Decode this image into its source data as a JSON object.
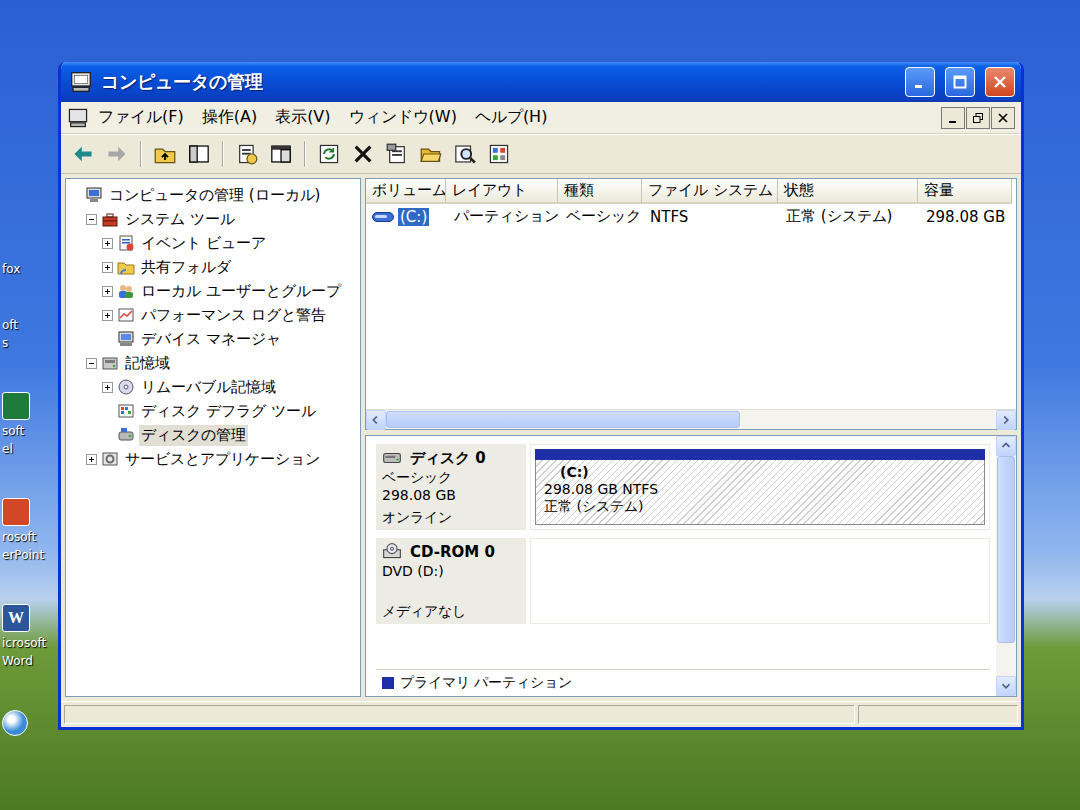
{
  "desktop_icons": [
    {
      "lines": [
        "fox"
      ],
      "kind": "none"
    },
    {
      "lines": [
        "oft",
        "s"
      ],
      "kind": "none"
    },
    {
      "lines": [
        "soft",
        "el"
      ],
      "kind": "tile",
      "color": "#1d7a3a"
    },
    {
      "lines": [
        "rosoft",
        "erPoint"
      ],
      "kind": "tile",
      "color": "#d24726"
    },
    {
      "lines": [
        "icrosoft",
        "Word"
      ],
      "kind": "tile",
      "color": "#2b579a",
      "glyph": "W"
    },
    {
      "lines": [],
      "kind": "round",
      "color": "#3b8ad8"
    }
  ],
  "window": {
    "title": "コンピュータの管理",
    "active": true
  },
  "menu": [
    "ファイル(F)",
    "操作(A)",
    "表示(V)",
    "ウィンドウ(W)",
    "ヘルプ(H)"
  ],
  "toolbar": [
    {
      "kind": "back",
      "disabled": false
    },
    {
      "kind": "forward",
      "disabled": true
    },
    {
      "kind": "separator",
      "disabled": false
    },
    {
      "kind": "up-folder",
      "disabled": false
    },
    {
      "kind": "show-tree",
      "disabled": false
    },
    {
      "kind": "separator",
      "disabled": false
    },
    {
      "kind": "help",
      "disabled": false
    },
    {
      "kind": "console",
      "disabled": false
    },
    {
      "kind": "separator",
      "disabled": false
    },
    {
      "kind": "refresh",
      "disabled": false
    },
    {
      "kind": "delete",
      "disabled": false
    },
    {
      "kind": "properties",
      "disabled": false
    },
    {
      "kind": "open",
      "disabled": false
    },
    {
      "kind": "find",
      "disabled": false
    },
    {
      "kind": "settings",
      "disabled": false
    }
  ],
  "tree": [
    {
      "label": "コンピュータの管理 (ローカル)",
      "level": 0,
      "kind": "computer",
      "expandable": false,
      "expanded": false,
      "selected": false
    },
    {
      "label": "システム ツール",
      "level": 1,
      "kind": "toolbox",
      "expandable": true,
      "expanded": true,
      "selected": false
    },
    {
      "label": "イベント ビューア",
      "level": 2,
      "kind": "event-log",
      "expandable": true,
      "expanded": false,
      "selected": false
    },
    {
      "label": "共有フォルダ",
      "level": 2,
      "kind": "shared-folder",
      "expandable": true,
      "expanded": false,
      "selected": false
    },
    {
      "label": "ローカル ユーザーとグループ",
      "level": 2,
      "kind": "users",
      "expandable": true,
      "expanded": false,
      "selected": false
    },
    {
      "label": "パフォーマンス ログと警告",
      "level": 2,
      "kind": "performance",
      "expandable": true,
      "expanded": false,
      "selected": false
    },
    {
      "label": "デバイス マネージャ",
      "level": 2,
      "kind": "device-manager",
      "expandable": false,
      "expanded": false,
      "selected": false
    },
    {
      "label": "記憶域",
      "level": 1,
      "kind": "storage",
      "expandable": true,
      "expanded": true,
      "selected": false
    },
    {
      "label": "リムーバブル記憶域",
      "level": 2,
      "kind": "removable-storage",
      "expandable": true,
      "expanded": false,
      "selected": false
    },
    {
      "label": "ディスク デフラグ ツール",
      "level": 2,
      "kind": "defrag",
      "expandable": false,
      "expanded": false,
      "selected": false
    },
    {
      "label": "ディスクの管理",
      "level": 2,
      "kind": "disk-management",
      "expandable": false,
      "expanded": false,
      "selected": true
    },
    {
      "label": "サービスとアプリケーション",
      "level": 1,
      "kind": "services",
      "expandable": true,
      "expanded": false,
      "selected": false
    }
  ],
  "volume_table": {
    "columns": [
      "ボリューム",
      "レイアウト",
      "種類",
      "ファイル システム",
      "状態",
      "容量"
    ],
    "rows": [
      {
        "cells": [
          "(C:)",
          "パーティション",
          "ベーシック",
          "NTFS",
          "正常 (システム)",
          "298.08 GB"
        ],
        "selected": true
      }
    ],
    "horizontal_scrollbar": {
      "level": 0.58
    }
  },
  "disks": [
    {
      "name": "ディスク 0",
      "kind": "hard-disk",
      "lines": [
        "ベーシック",
        "298.08 GB",
        "オンライン"
      ],
      "partitions": [
        {
          "label": "(C:)",
          "size": "298.08 GB NTFS",
          "status": "正常 (システム)",
          "selected": true,
          "color": "#1f2fa8"
        }
      ]
    },
    {
      "name": "CD-ROM 0",
      "kind": "cd-rom",
      "lines": [
        "DVD (D:)",
        "メディアなし"
      ],
      "partitions": []
    }
  ],
  "disk_scrollbar": {
    "level": 0.85
  },
  "legend": [
    {
      "label": "プライマリ パーティション",
      "color": "#1f2fa8"
    }
  ]
}
